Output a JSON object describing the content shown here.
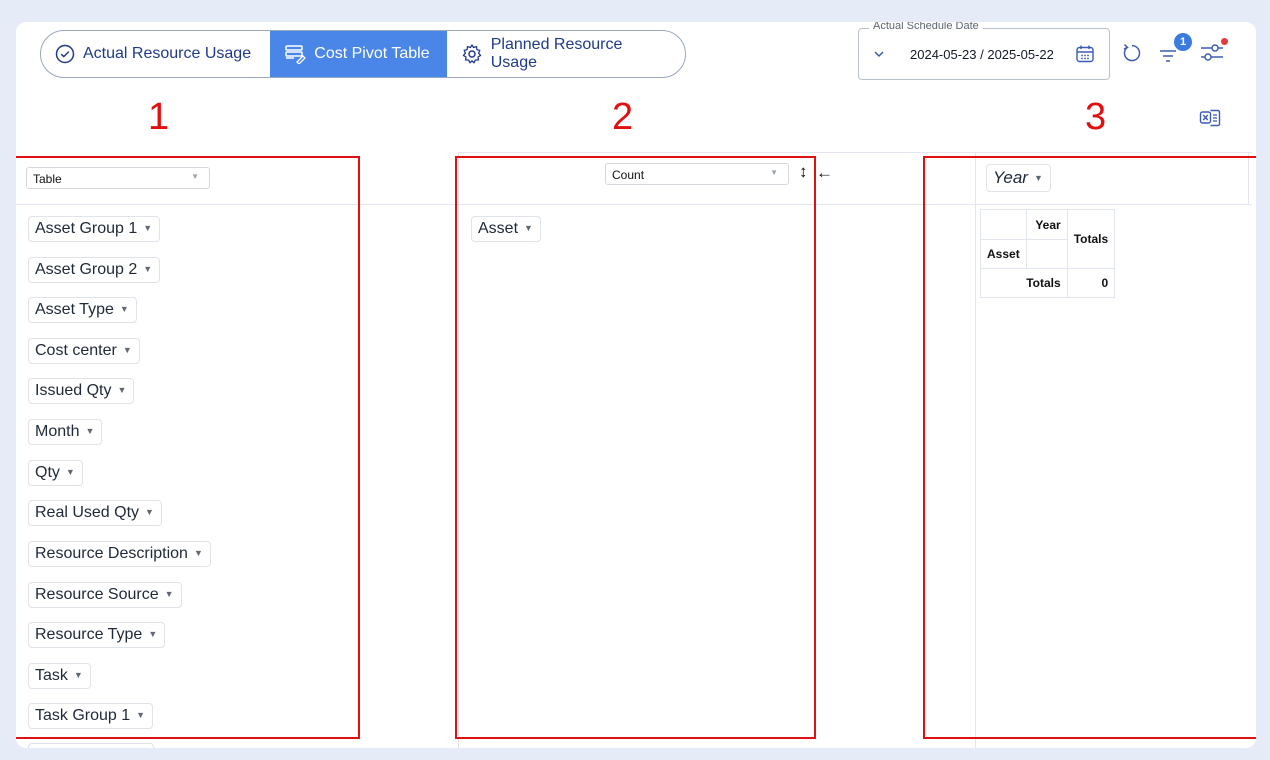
{
  "tabs": [
    {
      "label": "Actual Resource Usage",
      "icon": "check-circle-icon",
      "active": false
    },
    {
      "label": "Cost Pivot Table",
      "icon": "table-edit-icon",
      "active": true
    },
    {
      "label": "Planned Resource Usage",
      "icon": "gear-icon",
      "active": false
    }
  ],
  "date_filter": {
    "legend": "Actual Schedule Date",
    "value": "2024-05-23 / 2025-05-22"
  },
  "toolbar": {
    "filter_badge": "1"
  },
  "annotations": {
    "n1": "1",
    "n2": "2",
    "n3": "3"
  },
  "pivot": {
    "renderer_select": "Table",
    "aggregator_select": "Count",
    "sort_arrows": "↕",
    "sort_arrow_left": "←",
    "column_attribute": "Year",
    "row_attribute": "Asset",
    "unused_attributes": [
      "Asset Group 1",
      "Asset Group 2",
      "Asset Type",
      "Cost center",
      "Issued Qty",
      "Month",
      "Qty",
      "Real Used Qty",
      "Resource Description",
      "Resource Source",
      "Resource Type",
      "Task",
      "Task Group 1"
    ],
    "table": {
      "col_header": "Year",
      "row_header": "Asset",
      "totals_header": "Totals",
      "totals_row_label": "Totals",
      "totals_value": "0"
    }
  },
  "colors": {
    "accent": "#4a86e8",
    "annotation_red": "#e01010",
    "badge": "#3b7be0"
  }
}
